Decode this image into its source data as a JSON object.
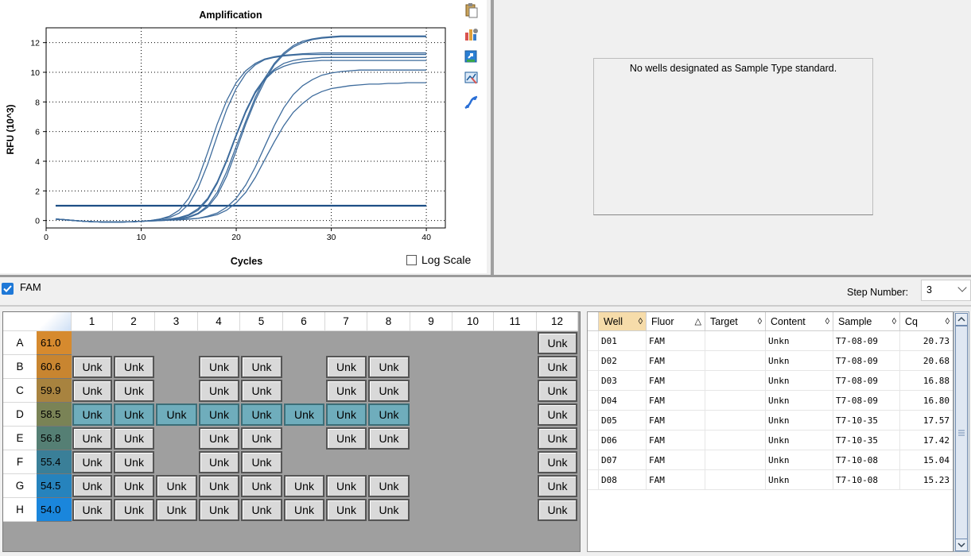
{
  "chart": {
    "icons": [
      "clipboard-icon",
      "chart-settings-icon",
      "export-icon",
      "chart-zoom-icon",
      "line-style-icon"
    ],
    "log_scale_label": "Log Scale"
  },
  "chart_data": {
    "type": "line",
    "title": "Amplification",
    "xlabel": "Cycles",
    "ylabel": "RFU (10^3)",
    "xlim": [
      0,
      42
    ],
    "ylim": [
      -0.5,
      13
    ],
    "xticks": [
      0,
      10,
      20,
      30,
      40
    ],
    "yticks": [
      0,
      2,
      4,
      6,
      8,
      10,
      12
    ],
    "grid": true,
    "threshold": 1.0,
    "x": [
      1,
      2,
      3,
      4,
      5,
      6,
      7,
      8,
      9,
      10,
      11,
      12,
      13,
      14,
      15,
      16,
      17,
      18,
      19,
      20,
      21,
      22,
      23,
      24,
      25,
      26,
      27,
      28,
      29,
      30,
      31,
      32,
      33,
      34,
      35,
      36,
      37,
      38,
      39,
      40
    ],
    "series": [
      {
        "values": [
          0.1,
          0.05,
          0.0,
          -0.05,
          -0.08,
          -0.1,
          -0.1,
          -0.1,
          -0.08,
          -0.05,
          0.0,
          0.1,
          0.3,
          0.7,
          1.5,
          2.8,
          4.6,
          6.5,
          8.1,
          9.3,
          10.1,
          10.6,
          10.9,
          11.05,
          11.15,
          11.2,
          11.25,
          11.28,
          11.3,
          11.3,
          11.3,
          11.3,
          11.3,
          11.3,
          11.3,
          11.3,
          11.3,
          11.3,
          11.3,
          11.3
        ]
      },
      {
        "values": [
          0.1,
          0.05,
          0.0,
          -0.05,
          -0.08,
          -0.1,
          -0.1,
          -0.1,
          -0.08,
          -0.05,
          0.0,
          0.1,
          0.2,
          0.5,
          1.1,
          2.2,
          3.8,
          5.7,
          7.5,
          8.9,
          9.9,
          10.5,
          10.85,
          11.0,
          11.1,
          11.15,
          11.2,
          11.2,
          11.2,
          11.2,
          11.2,
          11.2,
          11.2,
          11.2,
          11.2,
          11.2,
          11.2,
          11.2,
          11.2,
          11.2
        ]
      },
      {
        "values": [
          0.1,
          0.05,
          0.0,
          -0.05,
          -0.08,
          -0.1,
          -0.1,
          -0.1,
          -0.08,
          -0.05,
          -0.02,
          0.02,
          0.1,
          0.2,
          0.4,
          0.8,
          1.5,
          2.6,
          4.1,
          5.8,
          7.4,
          8.7,
          9.6,
          10.2,
          10.6,
          10.8,
          10.9,
          10.95,
          11.0,
          11.0,
          11.0,
          11.0,
          11.0,
          11.0,
          11.0,
          11.0,
          11.0,
          11.0,
          11.0,
          11.0
        ]
      },
      {
        "values": [
          0.1,
          0.05,
          0.0,
          -0.05,
          -0.08,
          -0.1,
          -0.1,
          -0.1,
          -0.08,
          -0.05,
          -0.02,
          0.02,
          0.08,
          0.15,
          0.35,
          0.7,
          1.4,
          2.5,
          4.0,
          5.7,
          7.3,
          8.6,
          9.5,
          10.1,
          10.4,
          10.6,
          10.7,
          10.75,
          10.8,
          10.8,
          10.8,
          10.8,
          10.8,
          10.8,
          10.8,
          10.8,
          10.8,
          10.8,
          10.8,
          10.8
        ]
      },
      {
        "values": [
          0.1,
          0.05,
          0.0,
          -0.05,
          -0.08,
          -0.1,
          -0.1,
          -0.1,
          -0.08,
          -0.05,
          -0.02,
          0.02,
          0.05,
          0.1,
          0.25,
          0.5,
          1.0,
          1.9,
          3.3,
          5.0,
          6.7,
          8.3,
          9.6,
          10.6,
          11.3,
          11.8,
          12.1,
          12.25,
          12.35,
          12.4,
          12.45,
          12.45,
          12.45,
          12.45,
          12.45,
          12.45,
          12.45,
          12.45,
          12.45,
          12.45
        ]
      },
      {
        "values": [
          0.1,
          0.05,
          0.0,
          -0.05,
          -0.08,
          -0.1,
          -0.1,
          -0.1,
          -0.08,
          -0.05,
          -0.02,
          0.02,
          0.05,
          0.1,
          0.2,
          0.45,
          0.9,
          1.7,
          3.0,
          4.7,
          6.5,
          8.1,
          9.4,
          10.5,
          11.2,
          11.7,
          12.0,
          12.2,
          12.3,
          12.35,
          12.4,
          12.4,
          12.4,
          12.4,
          12.4,
          12.4,
          12.4,
          12.4,
          12.4,
          12.4
        ]
      },
      {
        "values": [
          0.1,
          0.05,
          0.0,
          -0.05,
          -0.08,
          -0.1,
          -0.1,
          -0.1,
          -0.08,
          -0.05,
          -0.03,
          0.0,
          0.03,
          0.05,
          0.1,
          0.15,
          0.3,
          0.5,
          0.9,
          1.5,
          2.4,
          3.6,
          5.0,
          6.4,
          7.6,
          8.5,
          9.1,
          9.5,
          9.8,
          9.95,
          10.05,
          10.1,
          10.15,
          10.15,
          10.15,
          10.15,
          10.15,
          10.15,
          10.15,
          10.15
        ]
      },
      {
        "values": [
          0.1,
          0.05,
          0.0,
          -0.05,
          -0.08,
          -0.1,
          -0.1,
          -0.1,
          -0.08,
          -0.05,
          -0.03,
          0.0,
          0.03,
          0.05,
          0.1,
          0.15,
          0.25,
          0.4,
          0.7,
          1.2,
          1.9,
          2.9,
          4.1,
          5.3,
          6.4,
          7.3,
          7.9,
          8.4,
          8.7,
          8.9,
          9.0,
          9.1,
          9.15,
          9.2,
          9.2,
          9.25,
          9.25,
          9.3,
          9.3,
          9.3
        ]
      }
    ]
  },
  "standard_curve": {
    "message": "No wells designated as Sample Type standard."
  },
  "fluor": {
    "label": "FAM"
  },
  "step": {
    "label": "Step Number:",
    "value": "3"
  },
  "plate": {
    "columns": [
      "1",
      "2",
      "3",
      "4",
      "5",
      "6",
      "7",
      "8",
      "9",
      "10",
      "11",
      "12"
    ],
    "rows": [
      {
        "label": "A",
        "temp": "61.0",
        "temp_color": "#d68a2e",
        "wells": [
          "",
          "",
          "",
          "",
          "",
          "",
          "",
          "",
          "",
          "",
          "",
          "Unk"
        ],
        "selected": false
      },
      {
        "label": "B",
        "temp": "60.6",
        "temp_color": "#c88530",
        "wells": [
          "Unk",
          "Unk",
          "",
          "Unk",
          "Unk",
          "",
          "Unk",
          "Unk",
          "",
          "",
          "",
          "Unk"
        ],
        "selected": false
      },
      {
        "label": "C",
        "temp": "59.9",
        "temp_color": "#a8833f",
        "wells": [
          "Unk",
          "Unk",
          "",
          "Unk",
          "Unk",
          "",
          "Unk",
          "Unk",
          "",
          "",
          "",
          "Unk"
        ],
        "selected": false
      },
      {
        "label": "D",
        "temp": "58.5",
        "temp_color": "#7a8356",
        "wells": [
          "Unk",
          "Unk",
          "Unk",
          "Unk",
          "Unk",
          "Unk",
          "Unk",
          "Unk",
          "",
          "",
          "",
          "Unk"
        ],
        "selected": true
      },
      {
        "label": "E",
        "temp": "56.8",
        "temp_color": "#557f74",
        "wells": [
          "Unk",
          "Unk",
          "",
          "Unk",
          "Unk",
          "",
          "Unk",
          "Unk",
          "",
          "",
          "",
          "Unk"
        ],
        "selected": false
      },
      {
        "label": "F",
        "temp": "55.4",
        "temp_color": "#3a7f98",
        "wells": [
          "Unk",
          "Unk",
          "",
          "Unk",
          "Unk",
          "",
          "",
          "",
          "",
          "",
          "",
          "Unk"
        ],
        "selected": false
      },
      {
        "label": "G",
        "temp": "54.5",
        "temp_color": "#2683bd",
        "wells": [
          "Unk",
          "Unk",
          "Unk",
          "Unk",
          "Unk",
          "Unk",
          "Unk",
          "Unk",
          "",
          "",
          "",
          "Unk"
        ],
        "selected": false
      },
      {
        "label": "H",
        "temp": "54.0",
        "temp_color": "#1a86dc",
        "wells": [
          "Unk",
          "Unk",
          "Unk",
          "Unk",
          "Unk",
          "Unk",
          "Unk",
          "Unk",
          "",
          "",
          "",
          "Unk"
        ],
        "selected": false
      }
    ]
  },
  "table": {
    "headers": [
      {
        "label": "Well",
        "sort": "◊",
        "active": true
      },
      {
        "label": "Fluor",
        "sort": "△",
        "active": false
      },
      {
        "label": "Target",
        "sort": "◊",
        "active": false
      },
      {
        "label": "Content",
        "sort": "◊",
        "active": false
      },
      {
        "label": "Sample",
        "sort": "◊",
        "active": false
      },
      {
        "label": "Cq",
        "sort": "◊",
        "active": false
      }
    ],
    "rows": [
      [
        "D01",
        "FAM",
        "",
        "Unkn",
        "T7-08-09",
        "20.73"
      ],
      [
        "D02",
        "FAM",
        "",
        "Unkn",
        "T7-08-09",
        "20.68"
      ],
      [
        "D03",
        "FAM",
        "",
        "Unkn",
        "T7-08-09",
        "16.88"
      ],
      [
        "D04",
        "FAM",
        "",
        "Unkn",
        "T7-08-09",
        "16.80"
      ],
      [
        "D05",
        "FAM",
        "",
        "Unkn",
        "T7-10-35",
        "17.57"
      ],
      [
        "D06",
        "FAM",
        "",
        "Unkn",
        "T7-10-35",
        "17.42"
      ],
      [
        "D07",
        "FAM",
        "",
        "Unkn",
        "T7-10-08",
        "15.04"
      ],
      [
        "D08",
        "FAM",
        "",
        "Unkn",
        "T7-10-08",
        "15.23"
      ]
    ]
  },
  "colors": {
    "curve": "#3d6b9c",
    "threshold": "#1d4f86",
    "accent": "#1e78d7",
    "selected_well": "#6fadbc"
  }
}
